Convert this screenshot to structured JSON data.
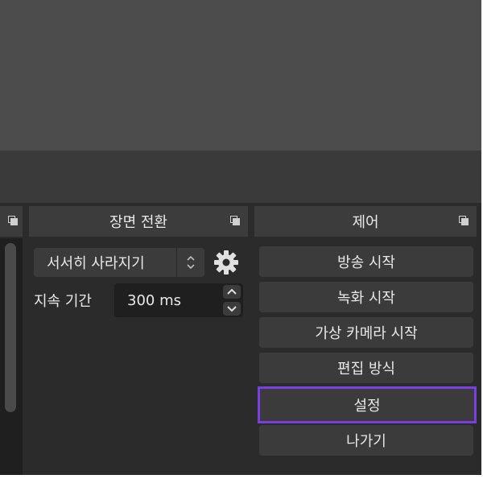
{
  "panels": {
    "transition": {
      "title": "장면 전환",
      "transition_select": "서서히 사라지기",
      "duration_label": "지속 기간",
      "duration_value": "300 ms"
    },
    "controls": {
      "title": "제어",
      "buttons": [
        {
          "label": "방송 시작"
        },
        {
          "label": "녹화 시작"
        },
        {
          "label": "가상 카메라 시작"
        },
        {
          "label": "편집 방식"
        },
        {
          "label": "설정"
        },
        {
          "label": "나가기"
        }
      ]
    }
  },
  "icons": {
    "undock": "undock-icon",
    "gear": "gear-icon",
    "spin_up": "chevron-up-icon",
    "spin_down": "chevron-down-icon"
  },
  "colors": {
    "highlight": "#7a3fe0",
    "preview_bg": "#4c4c4c",
    "button_bg": "#3b3b3b"
  }
}
